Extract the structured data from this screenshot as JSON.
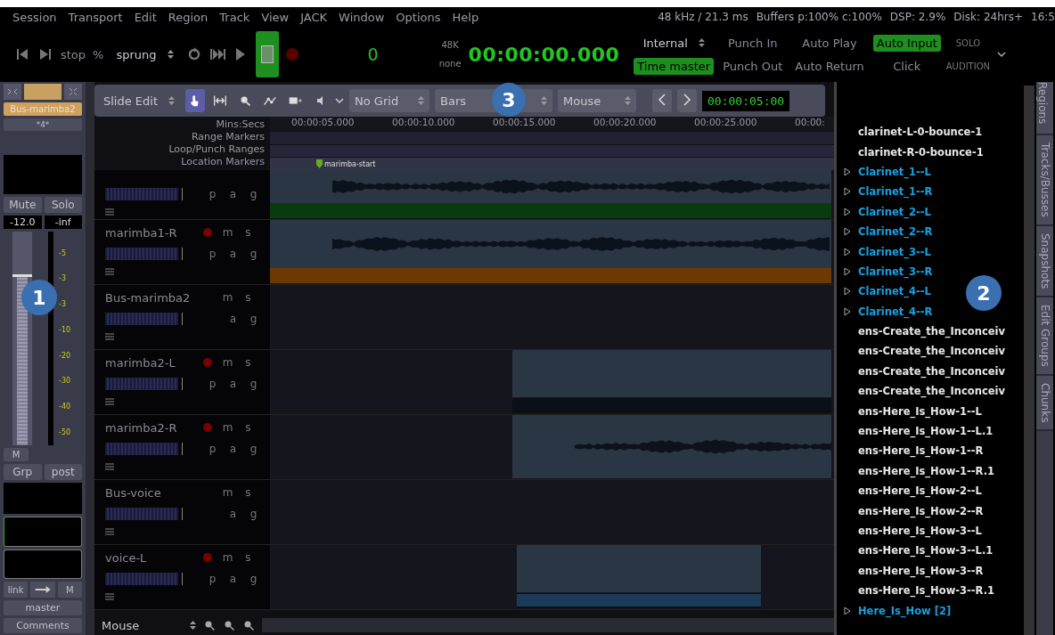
{
  "menu": [
    "Session",
    "Transport",
    "Edit",
    "Region",
    "Track",
    "View",
    "JACK",
    "Window",
    "Options",
    "Help"
  ],
  "status": [
    "48 kHz / 21.3 ms",
    "Buffers p:100% c:100%",
    "DSP:  2.9%",
    "Disk: 24hrs+",
    "16:5"
  ],
  "transport": {
    "shuttle_mode": "stop",
    "shuttle_unit": "%",
    "shuttle_style": "sprung",
    "stop_on": true,
    "record_on": false,
    "counter": "0",
    "rate": "48K",
    "pull": "none",
    "clock": "00:00:00.000",
    "sync": "Internal",
    "toggles": [
      {
        "label": "Punch In",
        "on": false
      },
      {
        "label": "Auto Play",
        "on": false
      },
      {
        "label": "Auto Input",
        "on": true
      },
      {
        "label": "Time master",
        "on": true
      },
      {
        "label": "Punch Out",
        "on": false
      },
      {
        "label": "Auto Return",
        "on": false
      },
      {
        "label": "Click",
        "on": false
      }
    ],
    "solo": "SOLO",
    "audition": "AUDITION"
  },
  "strip": {
    "name": "Bus-marimba2",
    "input": "*4*",
    "mute": "Mute",
    "solo": "Solo",
    "gain": "-12.0",
    "peak": "-inf",
    "level": 0.8,
    "scale": [
      "-5",
      "-3",
      "-3",
      "-10",
      "-20",
      "-30",
      "-40",
      "-50"
    ],
    "meter_button": "M",
    "group": "Grp",
    "point": "post",
    "link": "link",
    "mono": "M",
    "output": "master",
    "comments": "Comments"
  },
  "editor": {
    "edit_mode": "Slide Edit",
    "tools": [
      {
        "kind": "grab",
        "selected": true
      },
      {
        "kind": "range",
        "selected": false
      },
      {
        "kind": "zoom",
        "selected": false
      },
      {
        "kind": "gain",
        "selected": false
      },
      {
        "kind": "stretch",
        "selected": false
      },
      {
        "kind": "audition",
        "selected": false
      }
    ],
    "grid": "No Grid",
    "grid_unit": "Bars",
    "edit_point": "Mouse",
    "nudge_clock": "00:00:05:00",
    "rulers": [
      "Mins:Secs",
      "Range Markers",
      "Loop/Punch Ranges",
      "Location Markers"
    ],
    "ticks": [
      "00:00:05.000",
      "00:00:10.000",
      "00:00:15.000",
      "00:00:20.000",
      "00:00:25.000",
      "00:00:"
    ],
    "marker": "marimba-start",
    "tracks": [
      {
        "bottom": [
          "p",
          "a",
          "g"
        ]
      },
      {
        "name": "marimba1-R",
        "rec": true,
        "top": [
          "m",
          "s"
        ],
        "bottom": [
          "p",
          "a",
          "g"
        ]
      },
      {
        "name": "Bus-marimba2",
        "top": [
          "m",
          "s"
        ],
        "bottom": [
          "a",
          "g"
        ]
      },
      {
        "name": "marimba2-L",
        "rec": true,
        "top": [
          "m",
          "s"
        ],
        "bottom": [
          "p",
          "a",
          "g"
        ]
      },
      {
        "name": "marimba2-R",
        "rec": true,
        "top": [
          "m",
          "s"
        ],
        "bottom": [
          "p",
          "a",
          "g"
        ]
      },
      {
        "name": "Bus-voice",
        "top": [
          "m",
          "s"
        ],
        "bottom": [
          "a",
          "g"
        ]
      },
      {
        "name": "voice-L",
        "rec": true,
        "top": [
          "m",
          "s"
        ],
        "bottom": [
          "p",
          "a",
          "g"
        ]
      }
    ],
    "zoom_focus": "Mouse"
  },
  "regions": [
    {
      "label": "clarinet-L-0-bounce-1",
      "kind": "file"
    },
    {
      "label": "clarinet-R-0-bounce-1",
      "kind": "file"
    },
    {
      "label": "Clarinet_1--L",
      "kind": "folder"
    },
    {
      "label": "Clarinet_1--R",
      "kind": "folder"
    },
    {
      "label": "Clarinet_2--L",
      "kind": "folder"
    },
    {
      "label": "Clarinet_2--R",
      "kind": "folder"
    },
    {
      "label": "Clarinet_3--L",
      "kind": "folder"
    },
    {
      "label": "Clarinet_3--R",
      "kind": "folder"
    },
    {
      "label": "Clarinet_4--L",
      "kind": "folder"
    },
    {
      "label": "Clarinet_4--R",
      "kind": "folder"
    },
    {
      "label": "ens-Create_the_Inconceiv",
      "kind": "file"
    },
    {
      "label": "ens-Create_the_Inconceiv",
      "kind": "file"
    },
    {
      "label": "ens-Create_the_Inconceiv",
      "kind": "file"
    },
    {
      "label": "ens-Create_the_Inconceiv",
      "kind": "file"
    },
    {
      "label": "ens-Here_Is_How-1--L",
      "kind": "file"
    },
    {
      "label": "ens-Here_Is_How-1--L.1",
      "kind": "file"
    },
    {
      "label": "ens-Here_Is_How-1--R",
      "kind": "file"
    },
    {
      "label": "ens-Here_Is_How-1--R.1",
      "kind": "file"
    },
    {
      "label": "ens-Here_Is_How-2--L",
      "kind": "file"
    },
    {
      "label": "ens-Here_Is_How-2--R",
      "kind": "file"
    },
    {
      "label": "ens-Here_Is_How-3--L",
      "kind": "file"
    },
    {
      "label": "ens-Here_Is_How-3--L.1",
      "kind": "file"
    },
    {
      "label": "ens-Here_Is_How-3--R",
      "kind": "file"
    },
    {
      "label": "ens-Here_Is_How-3--R.1",
      "kind": "file"
    },
    {
      "label": "Here_Is_How [2]",
      "kind": "folder"
    }
  ],
  "side_tabs": [
    {
      "label": "Regions",
      "selected": false
    },
    {
      "label": "Tracks/Busses",
      "selected": false
    },
    {
      "label": "Snapshots",
      "selected": false
    },
    {
      "label": "Edit Groups",
      "selected": false
    },
    {
      "label": "Chunks",
      "selected": false
    }
  ],
  "callouts": [
    "1",
    "2",
    "3"
  ]
}
